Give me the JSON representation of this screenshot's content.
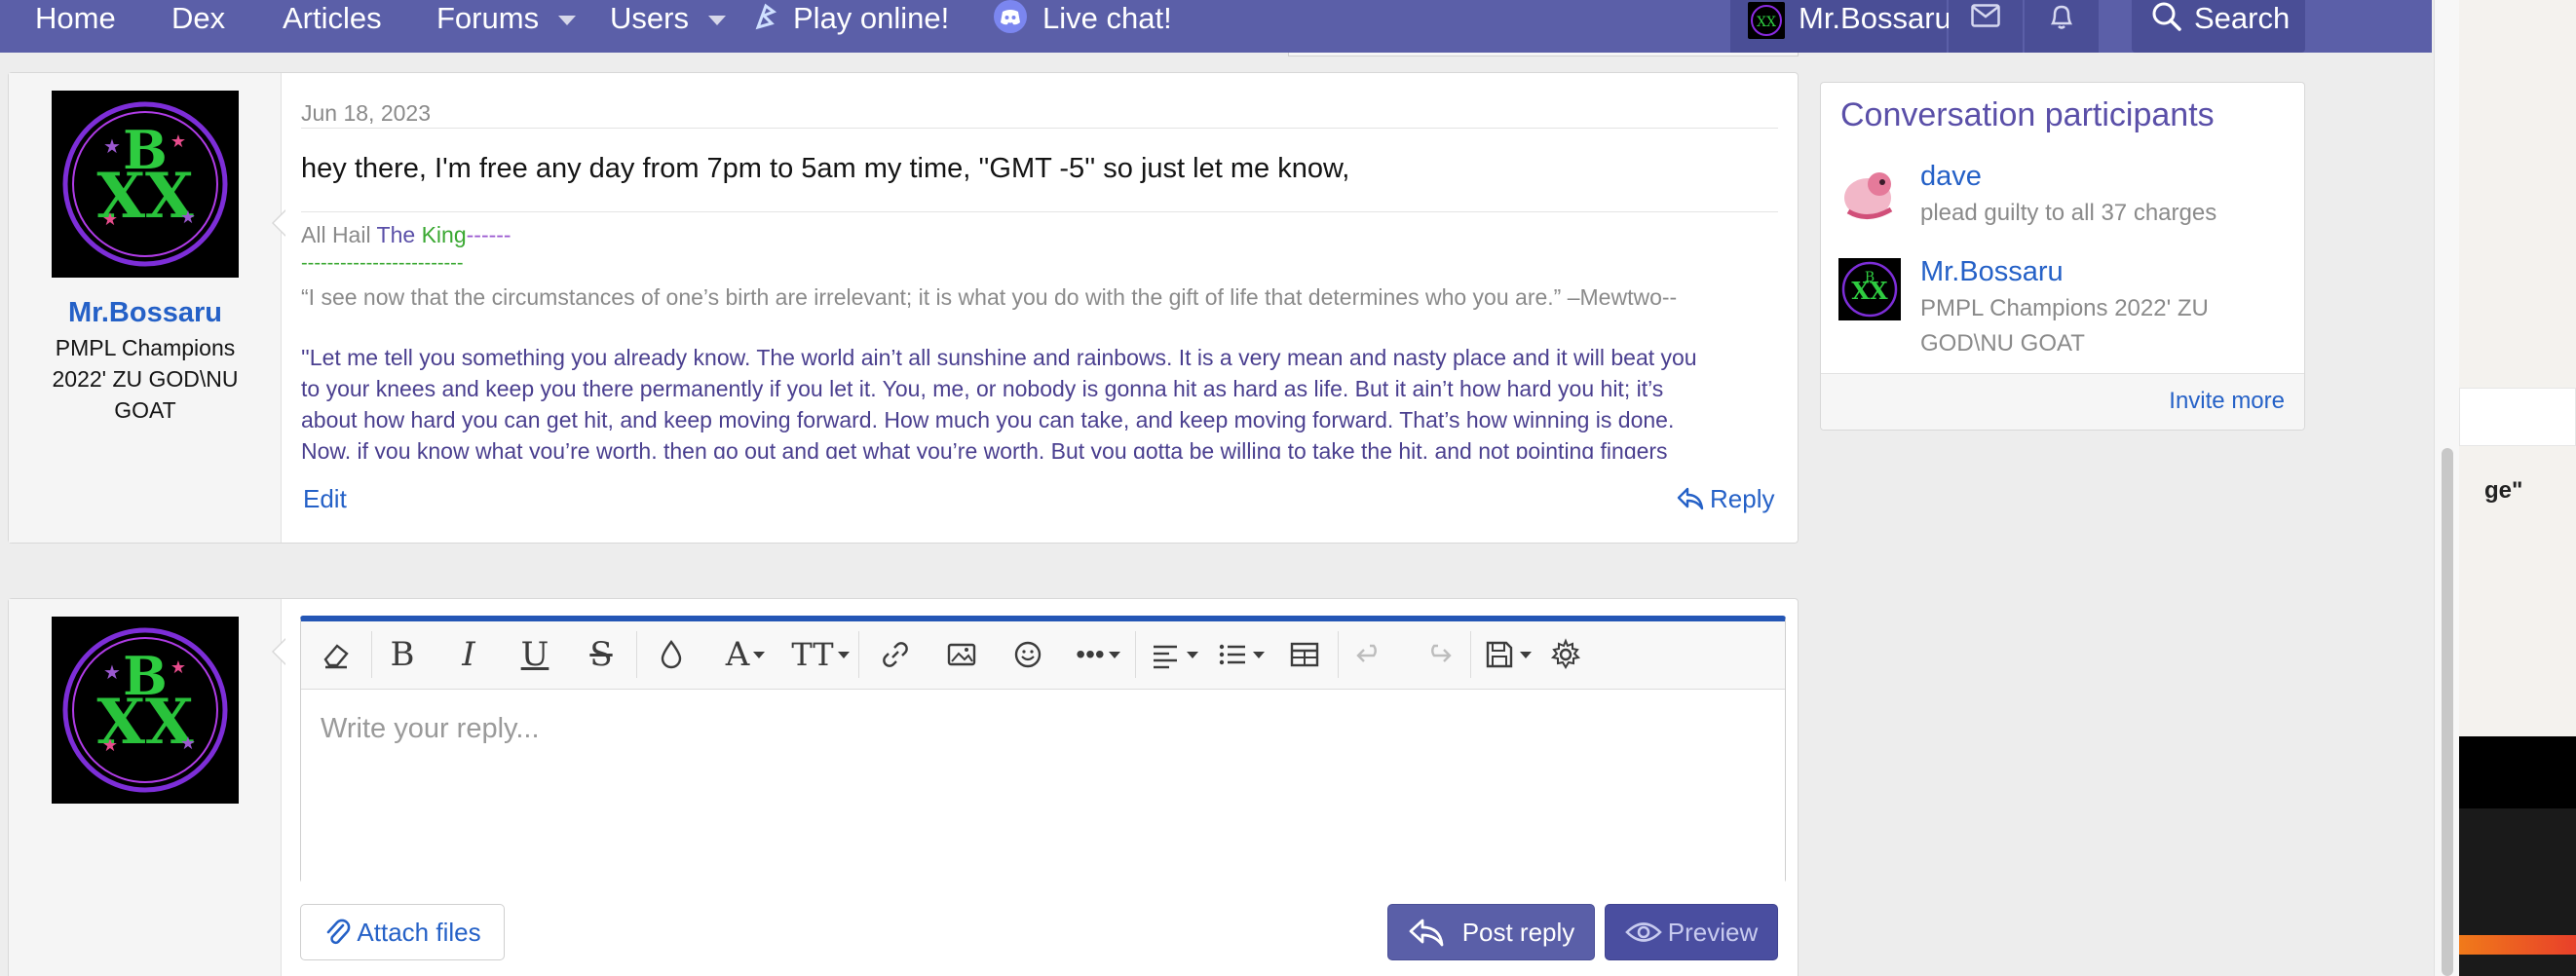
{
  "nav": {
    "home": "Home",
    "dex": "Dex",
    "articles": "Articles",
    "forums": "Forums",
    "users": "Users",
    "play_online": "Play online!",
    "live_chat": "Live chat!",
    "account_name": "Mr.Bossaru",
    "search": "Search"
  },
  "post": {
    "date": "Jun 18, 2023",
    "author": "Mr.Bossaru",
    "author_title": "PMPL Champions 2022' ZU GOD\\NU GOAT",
    "body": "hey there, I'm free any day from 7pm to 5am my time, ''GMT -5'' so just let me know,",
    "sig_all": "All Hail ",
    "sig_the": "The",
    "sig_king": "King",
    "sig_dashes1": "------",
    "sig_dashes2": "-------------------------",
    "sig_quote1": "“I see now that the circumstances of one’s birth are irrelevant; it is what you do with the gift of life that determines who you are.” –Mewtwo--",
    "sig_quote2_l1": "''Let me tell you something you already know. The world ain’t all sunshine and rainbows. It is a very mean and nasty place and it will beat you",
    "sig_quote2_l2": "to your knees and keep you there permanently if you let it. You, me, or nobody is gonna hit as hard as life. But it ain’t how hard you hit; it’s",
    "sig_quote2_l3": "about how hard you can get hit, and keep moving forward. How much you can take, and keep moving forward. That’s how winning is done.",
    "sig_quote2_l4": "Now, if you know what you’re worth, then go out and get what you’re worth. But you gotta be willing to take the hit, and not pointing fingers",
    "edit": "Edit",
    "reply": "Reply"
  },
  "participants": {
    "title": "Conversation participants",
    "list": [
      {
        "name": "dave",
        "title": "plead guilty to all 37 charges"
      },
      {
        "name": "Mr.Bossaru",
        "title_l1": "PMPL Champions 2022' ZU",
        "title_l2": "GOD\\NU GOAT"
      }
    ],
    "invite": "Invite more"
  },
  "editor": {
    "placeholder": "Write your reply...",
    "attach": "Attach files",
    "post_reply": "Post reply",
    "preview": "Preview"
  },
  "background_window": {
    "fragment": "ge\""
  },
  "colors": {
    "nav": "#5b5fa8",
    "link": "#2561c7",
    "accent_purple": "#5a4fa8",
    "sig_green": "#3aa832",
    "editor_top": "#2456b5"
  }
}
